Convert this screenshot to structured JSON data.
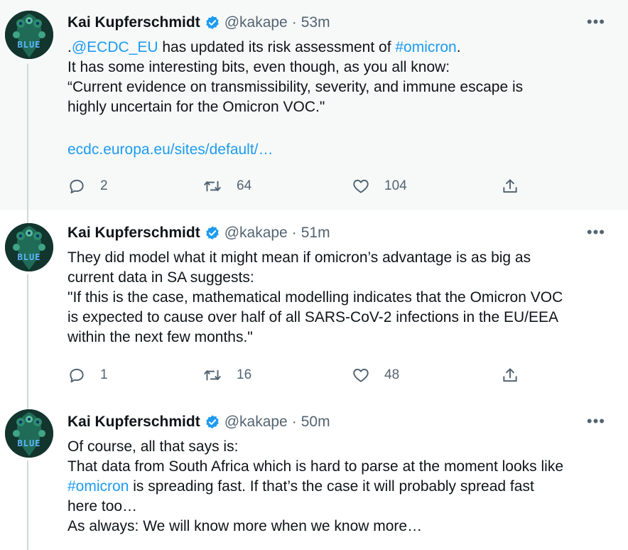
{
  "author": {
    "name": "Kai Kupferschmidt",
    "handle": "@kakape",
    "separator": "·",
    "avatar_text": "BLUE"
  },
  "colors": {
    "link": "#1d9bf0",
    "text": "#0f1419",
    "muted": "#536471",
    "verified": "#1d9bf0",
    "highlight_bg": "#f7f9f9"
  },
  "icons": {
    "verified": "verified-badge-icon",
    "more": "more-horizontal-icon",
    "reply": "reply-icon",
    "retweet": "retweet-icon",
    "like": "heart-icon",
    "share": "share-icon"
  },
  "more_glyph": "•••",
  "tweets": [
    {
      "time": "53m",
      "lines": {
        "l1_pre": ".",
        "l1_mention": "@ECDC_EU",
        "l1_mid": " has updated its risk assessment of ",
        "l1_hashtag": "#omicron",
        "l1_post": ".",
        "l2": "It has some interesting bits, even though, as you all know:",
        "l3": "“Current evidence on transmissibility, severity, and immune escape is",
        "l4": "highly uncertain for the Omicron VOC.\"",
        "url": "ecdc.europa.eu/sites/default/…"
      },
      "replies": "2",
      "retweets": "64",
      "likes": "104"
    },
    {
      "time": "51m",
      "lines": {
        "l1": "They did model what it might mean if omicron’s advantage is as big as",
        "l2": "current data in SA suggests:",
        "l3": "\"If this is the case, mathematical modelling indicates that the Omicron VOC",
        "l4": "is expected to cause over half of all SARS-CoV-2 infections in the EU/EEA",
        "l5": "within the next few months.\""
      },
      "replies": "1",
      "retweets": "16",
      "likes": "48"
    },
    {
      "time": "50m",
      "lines": {
        "l1": "Of course, all that says is:",
        "l2": "That data from South Africa which is hard to parse at the moment looks like",
        "l3_hashtag": "#omicron",
        "l3_post": " is spreading fast. If that’s the case it will probably spread fast",
        "l4": "here too…",
        "l5": "As always: We will know more when we know more…"
      }
    }
  ]
}
